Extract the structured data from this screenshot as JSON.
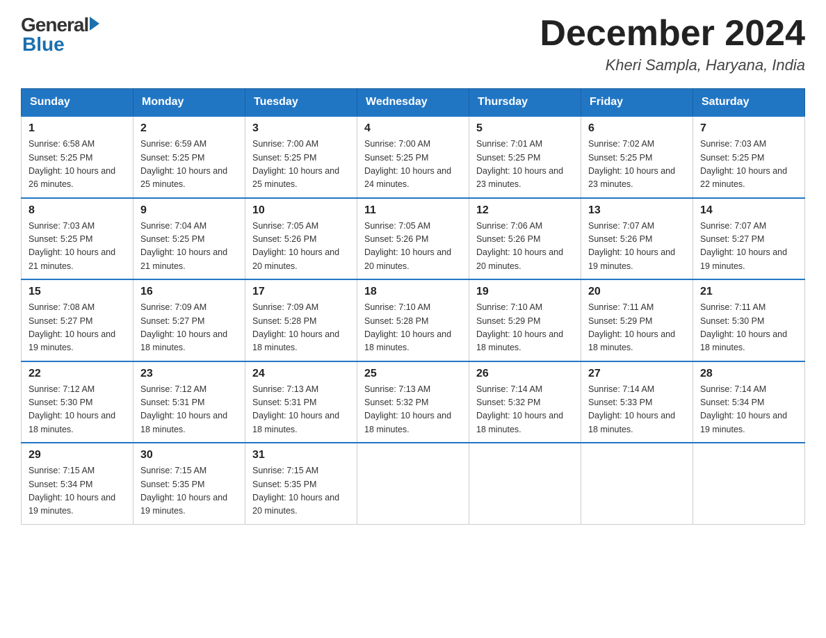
{
  "logo": {
    "general": "General",
    "blue": "Blue"
  },
  "title": "December 2024",
  "location": "Kheri Sampla, Haryana, India",
  "days_of_week": [
    "Sunday",
    "Monday",
    "Tuesday",
    "Wednesday",
    "Thursday",
    "Friday",
    "Saturday"
  ],
  "weeks": [
    [
      {
        "day": "1",
        "sunrise": "6:58 AM",
        "sunset": "5:25 PM",
        "daylight": "10 hours and 26 minutes."
      },
      {
        "day": "2",
        "sunrise": "6:59 AM",
        "sunset": "5:25 PM",
        "daylight": "10 hours and 25 minutes."
      },
      {
        "day": "3",
        "sunrise": "7:00 AM",
        "sunset": "5:25 PM",
        "daylight": "10 hours and 25 minutes."
      },
      {
        "day": "4",
        "sunrise": "7:00 AM",
        "sunset": "5:25 PM",
        "daylight": "10 hours and 24 minutes."
      },
      {
        "day": "5",
        "sunrise": "7:01 AM",
        "sunset": "5:25 PM",
        "daylight": "10 hours and 23 minutes."
      },
      {
        "day": "6",
        "sunrise": "7:02 AM",
        "sunset": "5:25 PM",
        "daylight": "10 hours and 23 minutes."
      },
      {
        "day": "7",
        "sunrise": "7:03 AM",
        "sunset": "5:25 PM",
        "daylight": "10 hours and 22 minutes."
      }
    ],
    [
      {
        "day": "8",
        "sunrise": "7:03 AM",
        "sunset": "5:25 PM",
        "daylight": "10 hours and 21 minutes."
      },
      {
        "day": "9",
        "sunrise": "7:04 AM",
        "sunset": "5:25 PM",
        "daylight": "10 hours and 21 minutes."
      },
      {
        "day": "10",
        "sunrise": "7:05 AM",
        "sunset": "5:26 PM",
        "daylight": "10 hours and 20 minutes."
      },
      {
        "day": "11",
        "sunrise": "7:05 AM",
        "sunset": "5:26 PM",
        "daylight": "10 hours and 20 minutes."
      },
      {
        "day": "12",
        "sunrise": "7:06 AM",
        "sunset": "5:26 PM",
        "daylight": "10 hours and 20 minutes."
      },
      {
        "day": "13",
        "sunrise": "7:07 AM",
        "sunset": "5:26 PM",
        "daylight": "10 hours and 19 minutes."
      },
      {
        "day": "14",
        "sunrise": "7:07 AM",
        "sunset": "5:27 PM",
        "daylight": "10 hours and 19 minutes."
      }
    ],
    [
      {
        "day": "15",
        "sunrise": "7:08 AM",
        "sunset": "5:27 PM",
        "daylight": "10 hours and 19 minutes."
      },
      {
        "day": "16",
        "sunrise": "7:09 AM",
        "sunset": "5:27 PM",
        "daylight": "10 hours and 18 minutes."
      },
      {
        "day": "17",
        "sunrise": "7:09 AM",
        "sunset": "5:28 PM",
        "daylight": "10 hours and 18 minutes."
      },
      {
        "day": "18",
        "sunrise": "7:10 AM",
        "sunset": "5:28 PM",
        "daylight": "10 hours and 18 minutes."
      },
      {
        "day": "19",
        "sunrise": "7:10 AM",
        "sunset": "5:29 PM",
        "daylight": "10 hours and 18 minutes."
      },
      {
        "day": "20",
        "sunrise": "7:11 AM",
        "sunset": "5:29 PM",
        "daylight": "10 hours and 18 minutes."
      },
      {
        "day": "21",
        "sunrise": "7:11 AM",
        "sunset": "5:30 PM",
        "daylight": "10 hours and 18 minutes."
      }
    ],
    [
      {
        "day": "22",
        "sunrise": "7:12 AM",
        "sunset": "5:30 PM",
        "daylight": "10 hours and 18 minutes."
      },
      {
        "day": "23",
        "sunrise": "7:12 AM",
        "sunset": "5:31 PM",
        "daylight": "10 hours and 18 minutes."
      },
      {
        "day": "24",
        "sunrise": "7:13 AM",
        "sunset": "5:31 PM",
        "daylight": "10 hours and 18 minutes."
      },
      {
        "day": "25",
        "sunrise": "7:13 AM",
        "sunset": "5:32 PM",
        "daylight": "10 hours and 18 minutes."
      },
      {
        "day": "26",
        "sunrise": "7:14 AM",
        "sunset": "5:32 PM",
        "daylight": "10 hours and 18 minutes."
      },
      {
        "day": "27",
        "sunrise": "7:14 AM",
        "sunset": "5:33 PM",
        "daylight": "10 hours and 18 minutes."
      },
      {
        "day": "28",
        "sunrise": "7:14 AM",
        "sunset": "5:34 PM",
        "daylight": "10 hours and 19 minutes."
      }
    ],
    [
      {
        "day": "29",
        "sunrise": "7:15 AM",
        "sunset": "5:34 PM",
        "daylight": "10 hours and 19 minutes."
      },
      {
        "day": "30",
        "sunrise": "7:15 AM",
        "sunset": "5:35 PM",
        "daylight": "10 hours and 19 minutes."
      },
      {
        "day": "31",
        "sunrise": "7:15 AM",
        "sunset": "5:35 PM",
        "daylight": "10 hours and 20 minutes."
      },
      null,
      null,
      null,
      null
    ]
  ]
}
